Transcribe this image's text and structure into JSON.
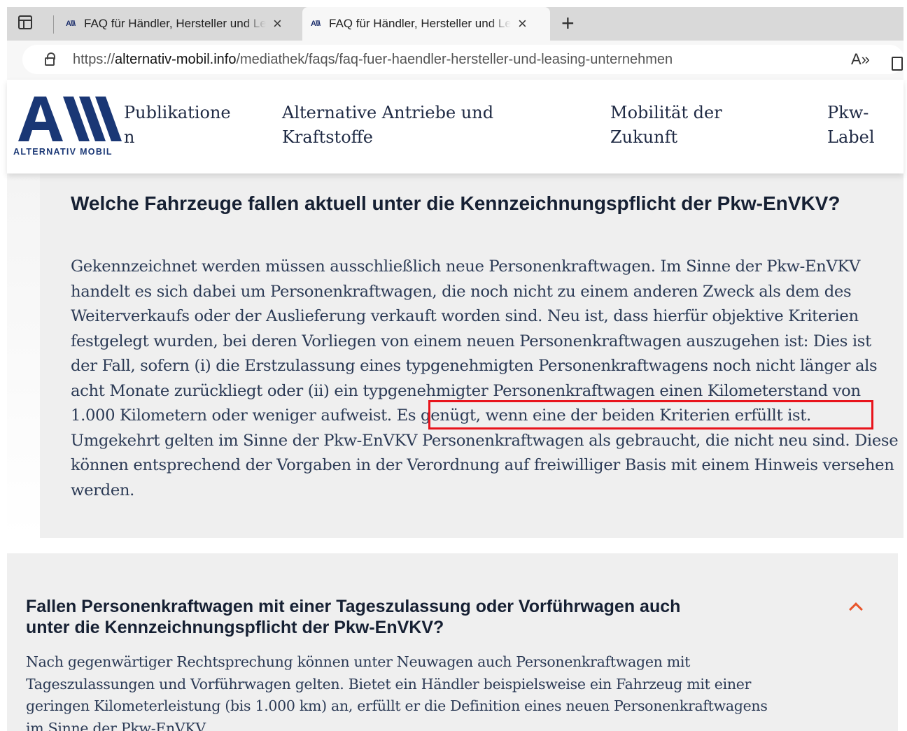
{
  "browser": {
    "tabs": [
      {
        "favicon": "A\\\\\\",
        "title": "FAQ für Händler, Hersteller und Leasing-Unternehmen",
        "close": "×"
      },
      {
        "favicon": "A\\\\\\",
        "title": "FAQ für Händler, Hersteller und Leasing-Unternehmen",
        "close": "×"
      }
    ],
    "new_tab": "+",
    "url_scheme": "https://",
    "url_host": "alternativ-mobil.info",
    "url_path": "/mediathek/faqs/faq-fuer-haendler-hersteller-und-leasing-unternehmen",
    "read_aloud": "A»",
    "icons": [
      "tab-actions-icon",
      "lock-icon",
      "read-aloud-icon",
      "sidebar-icon"
    ]
  },
  "site": {
    "logo_text": "ALTERNATIV MOBIL",
    "brand_color": "#1a3775",
    "nav": [
      {
        "line1": "Publikatione",
        "line2": "n"
      },
      {
        "line1": "Alternative Antriebe und",
        "line2": "Kraftstoffe"
      },
      {
        "line1": "Mobilität der",
        "line2": "Zukunft"
      },
      {
        "line1": "Pkw-",
        "line2": "Label"
      }
    ]
  },
  "faq": [
    {
      "question": "Welche Fahrzeuge fallen aktuell unter die Kennzeichnungspflicht der Pkw-EnVKV?",
      "answer_before": "Gekennzeichnet werden müssen ausschließlich neue Personenkraftwagen. Im Sinne der Pkw-EnVKV handelt es sich dabei um Personenkraftwagen, die noch nicht zu einem anderen Zweck als dem des Weiterverkaufs oder der Auslieferung verkauft worden sind. Neu ist, dass hierfür objektive Kriterien festgelegt wurden, bei deren Vorliegen von einem neuen Personenkraftwagen auszugehen ist: Dies ist der Fall, sofern (i) die Erstzulassung eines typgenehmigten Personenkraftwagens noch nicht länger als acht Monate zurückliegt oder (ii) ein typgenehmigter Personenkraftwagen einen Kilometerstand von 1.000 Kilometern oder weniger aufweist.",
      "answer_highlight": "Es genügt, wenn eine der beiden Kriterien erfüllt ist.",
      "answer_after": "Umgekehrt gelten im Sinne der Pkw-EnVKV Personenkraftwagen als gebraucht, die nicht neu sind. Diese können entsprechend der Vorgaben in der Verordnung auf freiwilliger Basis mit einem Hinweis versehen werden.",
      "highlight_color": "#e8141c"
    },
    {
      "question": "Fallen Personenkraftwagen mit einer Tageszulassung oder Vorführwagen auch unter die Kennzeichnungspflicht der Pkw-EnVKV?",
      "answer": "Nach gegenwärtiger Rechtsprechung können unter Neuwagen auch Personenkraftwagen mit Tageszulassungen und Vorführwagen gelten. Bietet ein Händler beispielsweise ein Fahrzeug mit einer geringen Kilometerleistung (bis 1.000 km) an, erfüllt er die Definition eines neuen Personenkraftwagens im Sinne der Pkw-EnVKV.",
      "toggle_icon": "chevron-up-icon",
      "accent_color": "#e8552b"
    }
  ]
}
